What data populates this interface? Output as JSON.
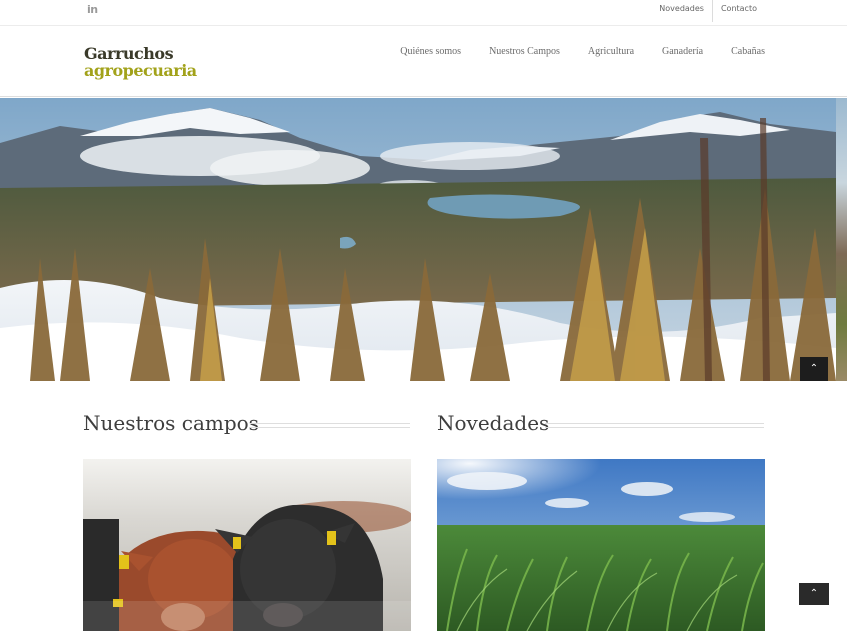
{
  "topbar": {
    "social_icon": "linkedin-icon",
    "social_label": "in",
    "links": [
      "Novedades",
      "Contacto"
    ]
  },
  "header": {
    "logo_line1": "Garruchos",
    "logo_line2": "agropecuaria",
    "nav": [
      "Quiénes somos",
      "Nuestros Campos",
      "Agricultura",
      "Ganadería",
      "Cabañas"
    ]
  },
  "hero": {
    "scroll_icon": "chevron-up-icon",
    "scroll_glyph": "⌃"
  },
  "sections": {
    "campos_title": "Nuestros campos",
    "novedades_title": "Novedades"
  },
  "scrolltop": {
    "icon": "chevron-up-icon",
    "glyph": "⌃"
  },
  "colors": {
    "logo_dark": "#3a3a2a",
    "logo_accent": "#a2a21a",
    "nav_text": "#6b6b6b",
    "button_dark": "#1d1d1d"
  }
}
